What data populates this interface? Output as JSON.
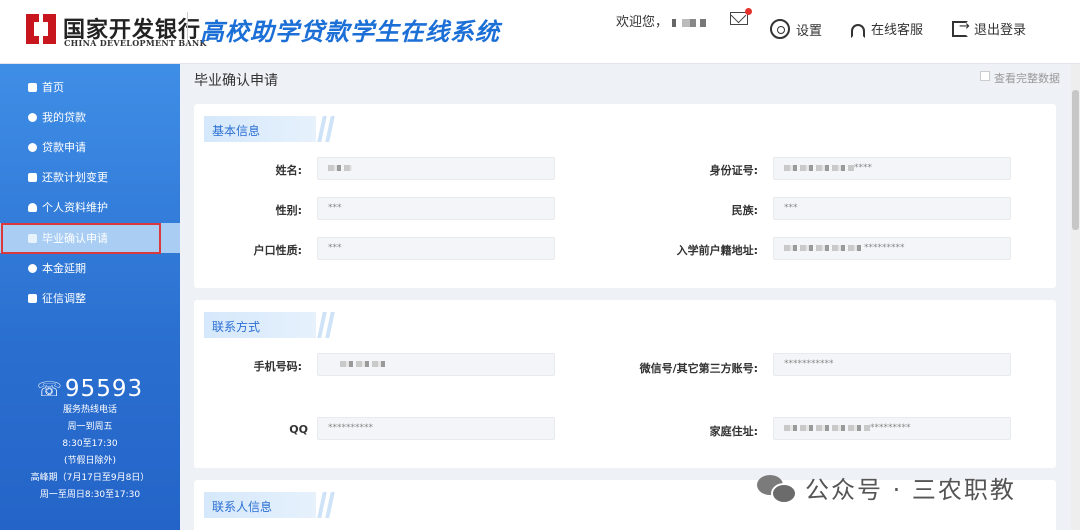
{
  "header": {
    "bank_name_cn": "国家开发银行",
    "bank_name_en": "CHINA DEVELOPMENT BANK",
    "system_title": "高校助学贷款学生在线系统",
    "welcome_text": "欢迎您，",
    "settings_label": "设置",
    "service_label": "在线客服",
    "logout_label": "退出登录"
  },
  "sidebar": {
    "items": [
      {
        "label": "首页",
        "icon": "home-icon"
      },
      {
        "label": "我的贷款",
        "icon": "loan-icon"
      },
      {
        "label": "贷款申请",
        "icon": "apply-icon"
      },
      {
        "label": "还款计划变更",
        "icon": "plan-icon"
      },
      {
        "label": "个人资料维护",
        "icon": "user-icon"
      },
      {
        "label": "毕业确认申请",
        "icon": "graduate-icon"
      },
      {
        "label": "本金延期",
        "icon": "defer-icon"
      },
      {
        "label": "征信调整",
        "icon": "credit-icon"
      }
    ],
    "active_index": 5,
    "hotline": {
      "number": "95593",
      "lines": [
        "服务热线电话",
        "周一到周五",
        "8:30至17:30",
        "(节假日除外)",
        "高峰期（7月17日至9月8日）",
        "周一至周日8:30至17:30"
      ]
    }
  },
  "main": {
    "page_title": "毕业确认申请",
    "full_data_label": "查看完整数据",
    "sections": {
      "basic": {
        "title": "基本信息",
        "name_label": "姓名:",
        "name_value": "",
        "id_label": "身份证号:",
        "id_value": "****",
        "gender_label": "性别:",
        "gender_value": "***",
        "ethnic_label": "民族:",
        "ethnic_value": "***",
        "hukou_label": "户口性质:",
        "hukou_value": "***",
        "address_label": "入学前户籍地址:",
        "address_value": "*********"
      },
      "contact": {
        "title": "联系方式",
        "phone_label": "手机号码:",
        "phone_value": "",
        "wechat_label": "微信号/其它第三方账号:",
        "wechat_value": "***********",
        "qq_label": "QQ",
        "qq_value": "**********",
        "home_label": "家庭住址:",
        "home_value": "*********"
      },
      "relatives": {
        "title": "联系人信息"
      }
    }
  },
  "watermark": {
    "text": "公众号 · 三农职教"
  }
}
